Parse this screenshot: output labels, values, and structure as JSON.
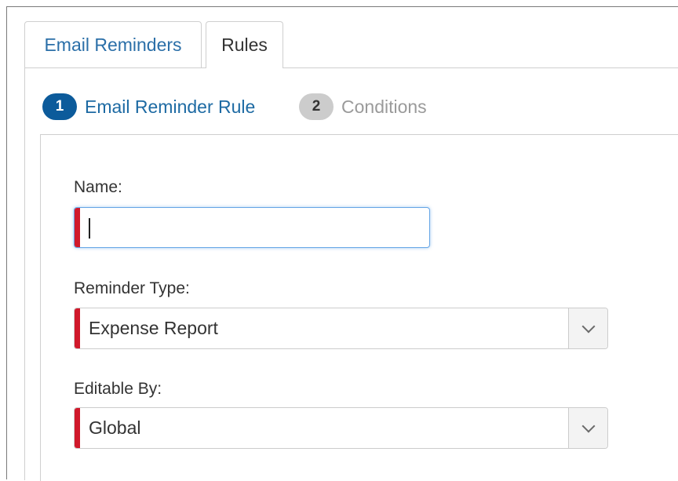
{
  "tabs": [
    {
      "label": "Email Reminders",
      "active": false
    },
    {
      "label": "Rules",
      "active": true
    }
  ],
  "steps": [
    {
      "number": "1",
      "label": "Email Reminder Rule",
      "active": true
    },
    {
      "number": "2",
      "label": "Conditions",
      "active": false
    }
  ],
  "form": {
    "name": {
      "label": "Name:",
      "value": ""
    },
    "reminder_type": {
      "label": "Reminder Type:",
      "selected": "Expense Report"
    },
    "editable_by": {
      "label": "Editable By:",
      "selected": "Global"
    }
  },
  "colors": {
    "link_blue": "#2b6fa8",
    "step_active": "#0c5b9b",
    "step_inactive": "#cccccc",
    "required": "#d0192b",
    "focus": "#66a6e6"
  },
  "icons": {
    "dropdown": "chevron-down-icon"
  }
}
